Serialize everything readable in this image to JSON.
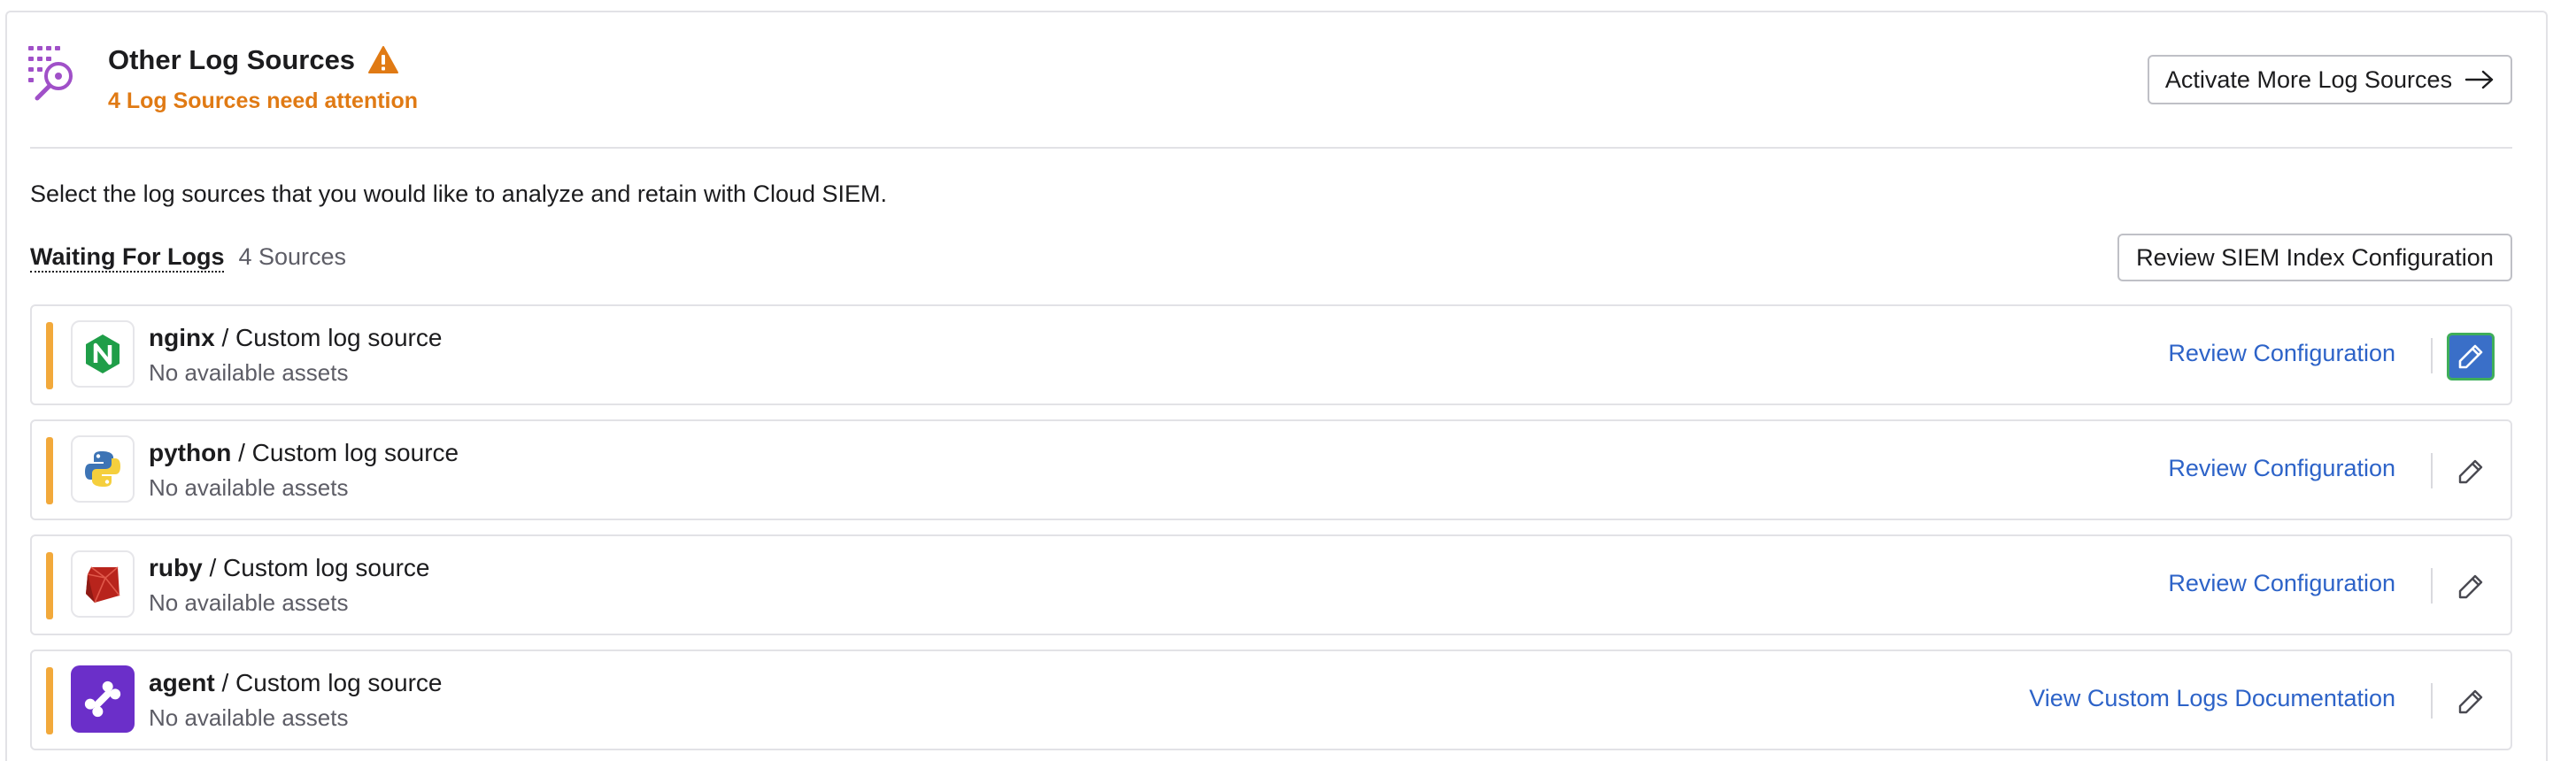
{
  "header": {
    "title": "Other Log Sources",
    "subtitle": "4 Log Sources need attention",
    "activate_button": "Activate More Log Sources"
  },
  "intro": "Select the log sources that you would like to analyze and retain with Cloud SIEM.",
  "waiting": {
    "label": "Waiting For Logs",
    "count": "4 Sources",
    "review_button": "Review SIEM Index Configuration"
  },
  "sources": [
    {
      "name": "nginx",
      "type": "/ Custom log source",
      "assets": "No available assets",
      "action": "Review Configuration",
      "icon": "nginx-icon"
    },
    {
      "name": "python",
      "type": "/ Custom log source",
      "assets": "No available assets",
      "action": "Review Configuration",
      "icon": "python-icon"
    },
    {
      "name": "ruby",
      "type": "/ Custom log source",
      "assets": "No available assets",
      "action": "Review Configuration",
      "icon": "ruby-icon"
    },
    {
      "name": "agent",
      "type": "/ Custom log source",
      "assets": "No available assets",
      "action": "View Custom Logs Documentation",
      "icon": "agent-bone-icon"
    }
  ],
  "colors": {
    "attention": "#e07a14",
    "status_bar": "#f2a93b",
    "link": "#2d63c8",
    "edit_active": "#3a6fc8",
    "header_icon": "#a050c8"
  }
}
